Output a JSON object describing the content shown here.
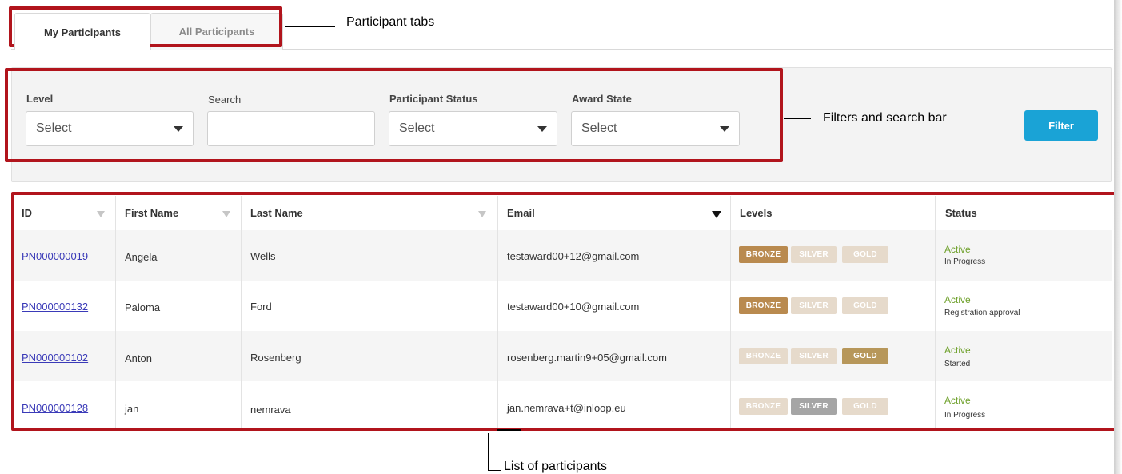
{
  "tabs": {
    "my_participants": "My Participants",
    "all_participants": "All Participants"
  },
  "filters": {
    "level_label": "Level",
    "level_value": "Select",
    "search_label": "Search",
    "search_value": "",
    "status_label": "Participant Status",
    "status_value": "Select",
    "award_label": "Award State",
    "award_value": "Select",
    "filter_button": "Filter"
  },
  "table": {
    "columns": [
      "ID",
      "First Name",
      "Last Name",
      "Email",
      "Levels",
      "Status"
    ],
    "level_names": [
      "BRONZE",
      "SILVER",
      "GOLD"
    ],
    "rows": [
      {
        "id": "PN000000019",
        "first": "Angela",
        "last": "Wells",
        "email": "testaward00+12@gmail.com",
        "active_level": "BRONZE",
        "status": "Active",
        "sub_status": "In Progress"
      },
      {
        "id": "PN000000132",
        "first": "Paloma",
        "last": "Ford",
        "email": "testaward00+10@gmail.com",
        "active_level": "BRONZE",
        "status": "Active",
        "sub_status": "Registration approval"
      },
      {
        "id": "PN000000102",
        "first": "Anton",
        "last": "Rosenberg",
        "email": "rosenberg.martin9+05@gmail.com",
        "active_level": "GOLD",
        "status": "Active",
        "sub_status": "Started"
      },
      {
        "id": "PN000000128",
        "first": "jan",
        "last": "nemrava",
        "email": "jan.nemrava+t@inloop.eu",
        "active_level": "SILVER",
        "status": "Active",
        "sub_status": "In Progress"
      }
    ]
  },
  "annotations": {
    "tabs": "Participant tabs",
    "filters": "Filters and search bar",
    "list": "List of participants"
  },
  "colors": {
    "highlight": "#b1141c",
    "filter_button": "#1aa3d6",
    "status_active": "#6fa12c",
    "bronze_active": "#b98a4f",
    "bronze_inactive": "#e6dacb",
    "silver_active": "#a5a5a5",
    "silver_inactive": "#e6dacb",
    "gold_active": "#b7975a",
    "gold_inactive": "#e6dacb"
  }
}
